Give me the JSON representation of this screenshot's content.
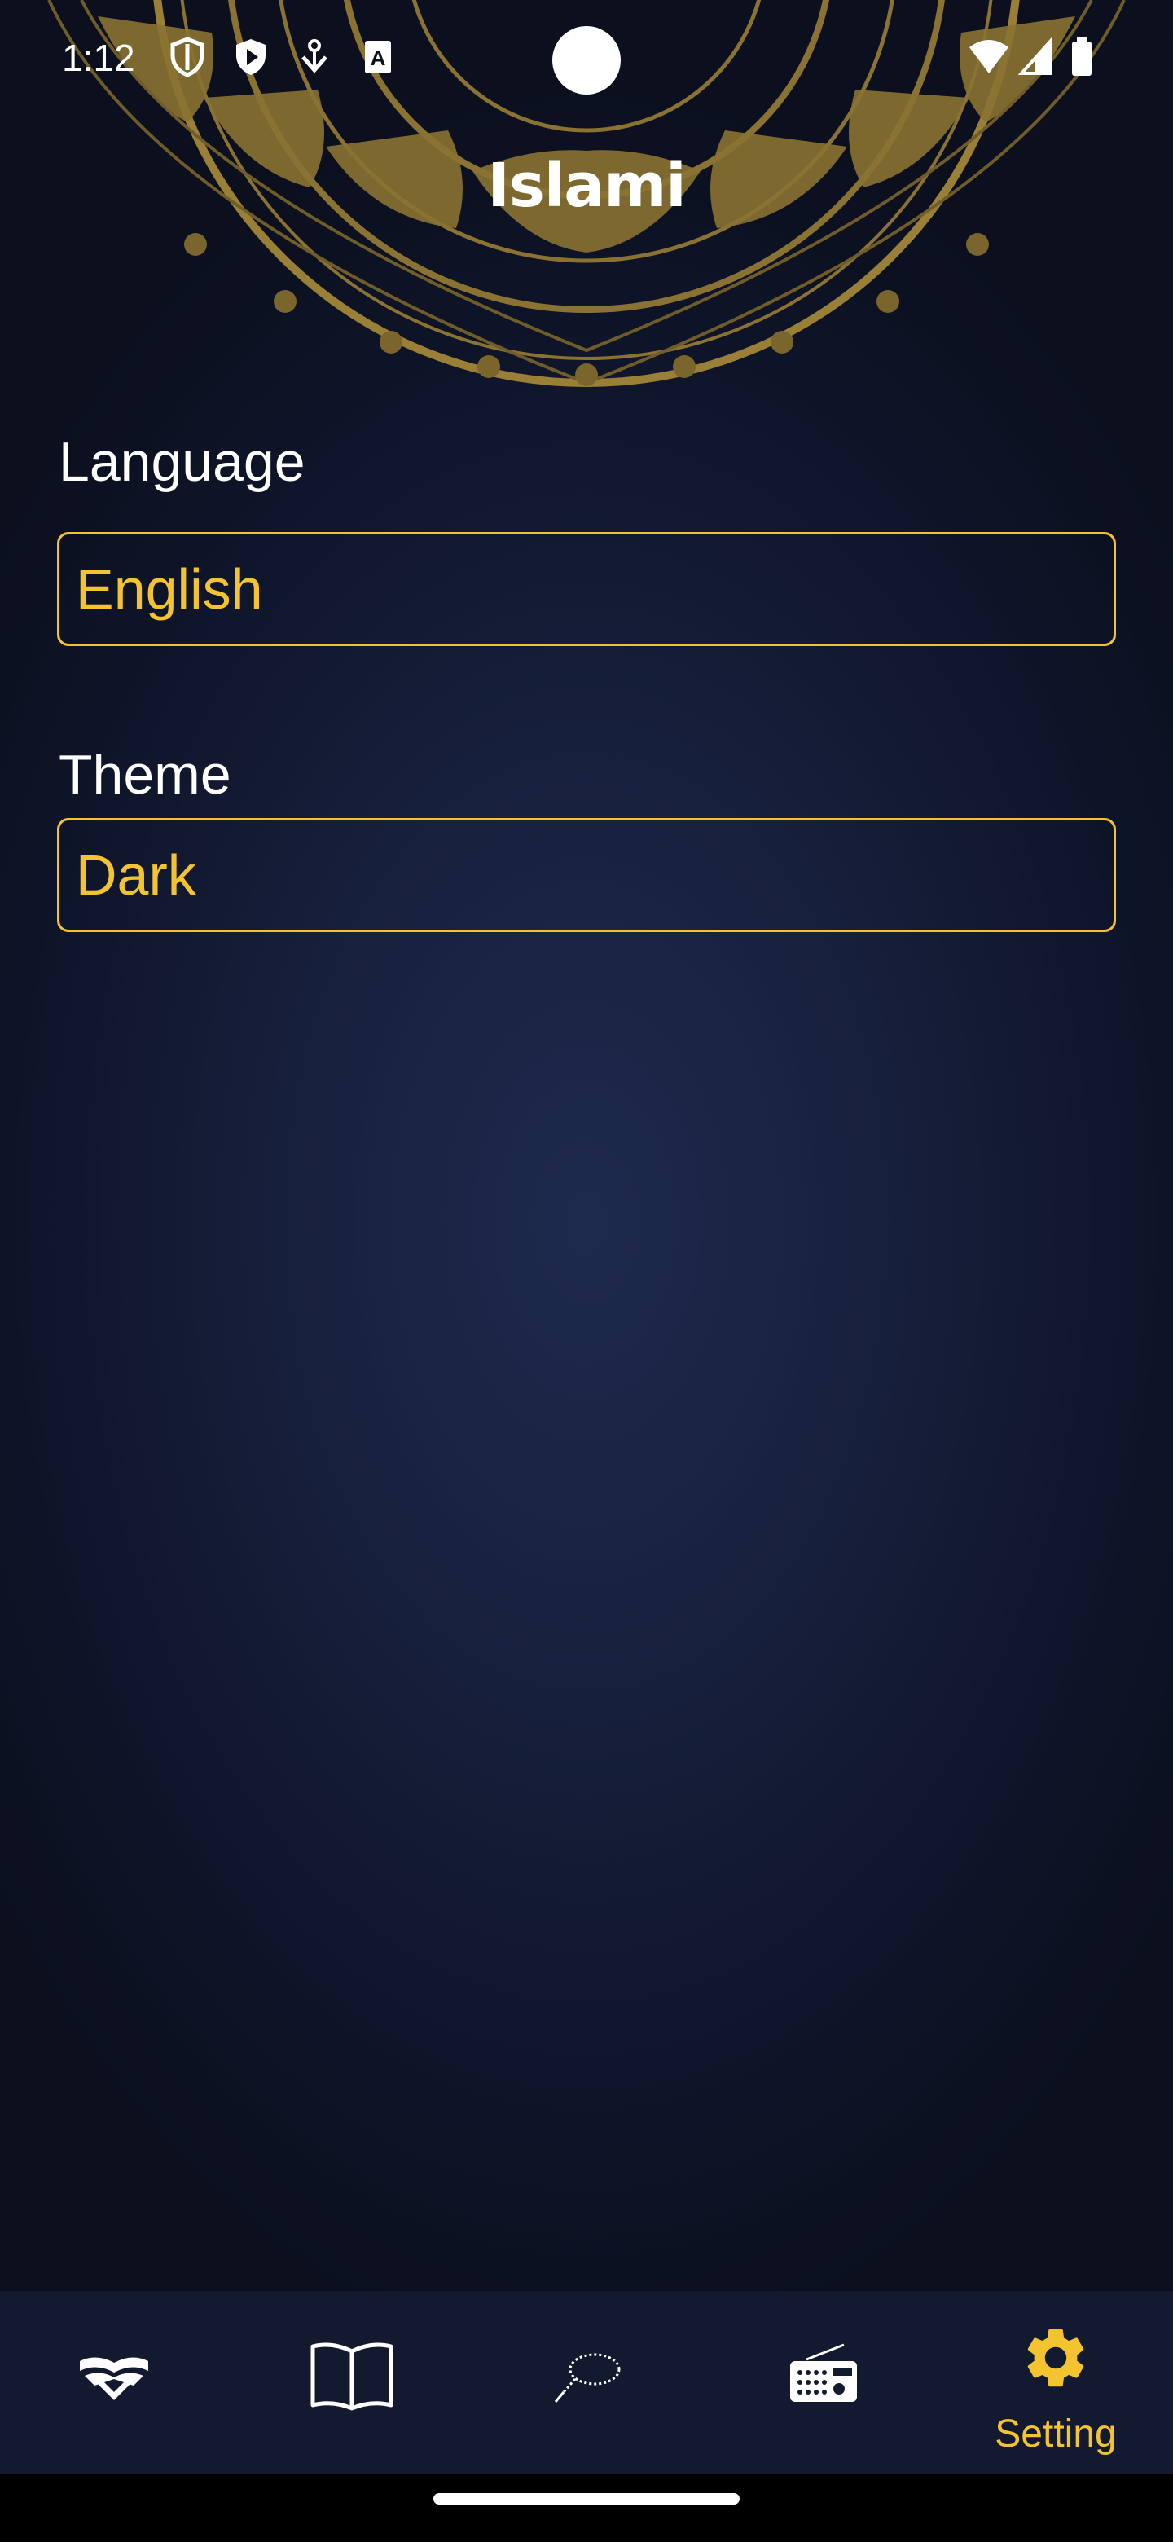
{
  "status_bar": {
    "time": "1:12",
    "icons": [
      "shield-icon",
      "play-protect-icon",
      "download-icon",
      "text-a-icon",
      "wifi-icon",
      "signal-icon",
      "battery-icon"
    ]
  },
  "header": {
    "title": "Islami",
    "background_ornament": "mandala-ornament"
  },
  "settings": {
    "language": {
      "label": "Language",
      "value": "English"
    },
    "theme": {
      "label": "Theme",
      "value": "Dark"
    }
  },
  "bottom_nav": {
    "items": [
      {
        "icon": "quran-icon",
        "label": ""
      },
      {
        "icon": "book-icon",
        "label": ""
      },
      {
        "icon": "tasbeeh-icon",
        "label": ""
      },
      {
        "icon": "radio-icon",
        "label": ""
      },
      {
        "icon": "gear-icon",
        "label": "Setting",
        "active": true
      }
    ]
  },
  "colors": {
    "accent": "#f4c430",
    "background_center": "#1e2a4e",
    "background_edge": "#0b0f1e",
    "nav_background": "#131a30",
    "text": "#ffffff"
  }
}
